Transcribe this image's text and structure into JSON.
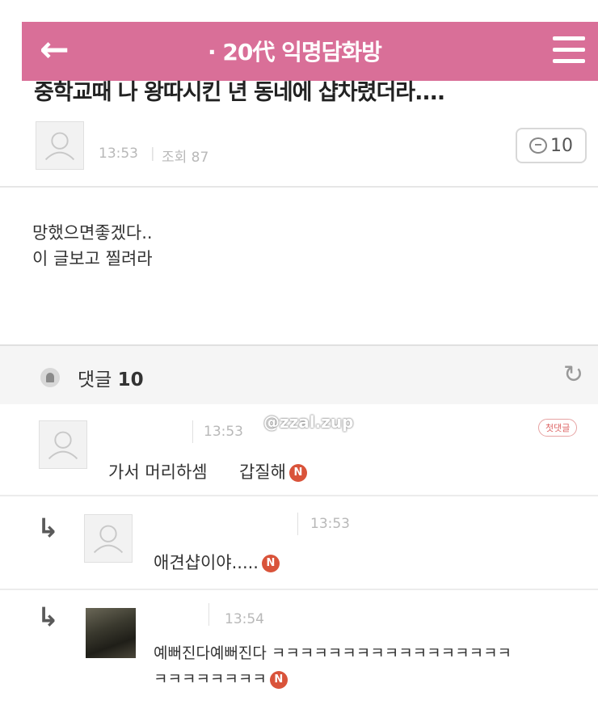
{
  "header": {
    "title": "· 20代 익명담화방",
    "back_icon": "back-arrow-icon",
    "menu_icon": "hamburger-menu-icon",
    "color": "#d96f98"
  },
  "post": {
    "title": "중학교때 나 왕따시킨 년 동네에 샵차렸더라....",
    "time": "13:53",
    "views": "조회 87",
    "comment_count": "10",
    "body_line1": "망했으면좋겠다..",
    "body_line2": "이 글보고 찔려라"
  },
  "comments_section": {
    "label": "댓글",
    "count": "10"
  },
  "watermark": "@zzal.zup",
  "comments": [
    {
      "time": "13:53",
      "text_part1": "가서 머리하셈 ",
      "text_part2": " 갑질해",
      "badge": "N",
      "tag": "첫댓글"
    },
    {
      "time": "13:53",
      "text": "애견샵이야.....",
      "badge": "N"
    },
    {
      "time": "13:54",
      "text_line1": "예뻐진다예뻐진다 ㅋㅋㅋㅋㅋㅋㅋㅋㅋㅋㅋㅋㅋㅋㅋㅋㅋ",
      "text_line2": "ㅋㅋㅋㅋㅋㅋㅋㅋ",
      "badge": "N"
    }
  ]
}
